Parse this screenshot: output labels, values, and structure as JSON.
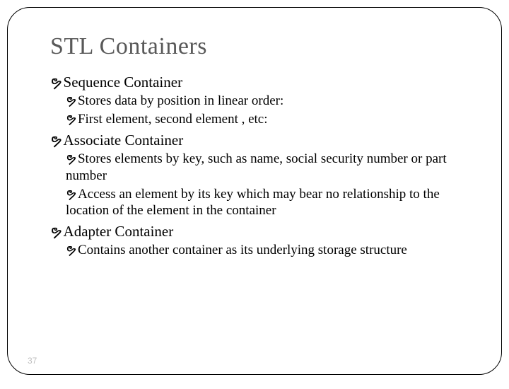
{
  "title": "STL Containers",
  "bullet_glyph": "ຯ",
  "items": [
    {
      "text": "Sequence Container",
      "children": [
        {
          "text": "Stores data by position in linear order:"
        },
        {
          "text": "First element, second element , etc:"
        }
      ]
    },
    {
      "text": "Associate Container",
      "children": [
        {
          "text": "Stores elements by key, such as name, social security number or part number"
        },
        {
          "text": "Access an element by its key which may bear no relationship to the location of the element in the container"
        }
      ]
    },
    {
      "text": "Adapter Container",
      "children": [
        {
          "text": "Contains another container as its underlying storage structure"
        }
      ]
    }
  ],
  "page_number": "37"
}
